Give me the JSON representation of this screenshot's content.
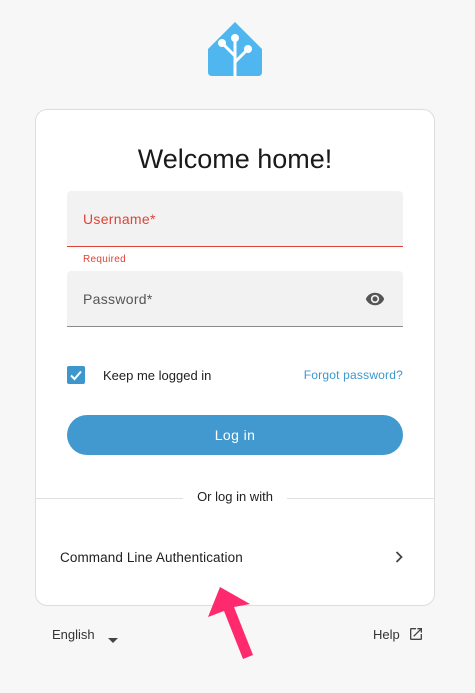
{
  "card": {
    "title": "Welcome home!",
    "username": {
      "label": "Username*",
      "helper": "Required"
    },
    "password": {
      "label": "Password*"
    },
    "keep_logged_in": {
      "label": "Keep me logged in",
      "checked": true
    },
    "forgot_password": "Forgot password?",
    "login_button": "Log in",
    "divider_text": "Or log in with",
    "providers": [
      {
        "label": "Command Line Authentication"
      }
    ]
  },
  "footer": {
    "language": "English",
    "help": "Help"
  },
  "colors": {
    "accent": "#4199cf",
    "error": "#db4437",
    "logo": "#4fb6ef",
    "annotation_arrow": "#ff2a6d"
  },
  "icons": {
    "logo": "home-assistant-logo-icon",
    "password_toggle": "eye-icon",
    "checkbox": "checkmark-icon",
    "provider_arrow": "chevron-right-icon",
    "language_dropdown": "caret-down-icon",
    "help_link": "open-in-new-icon"
  }
}
